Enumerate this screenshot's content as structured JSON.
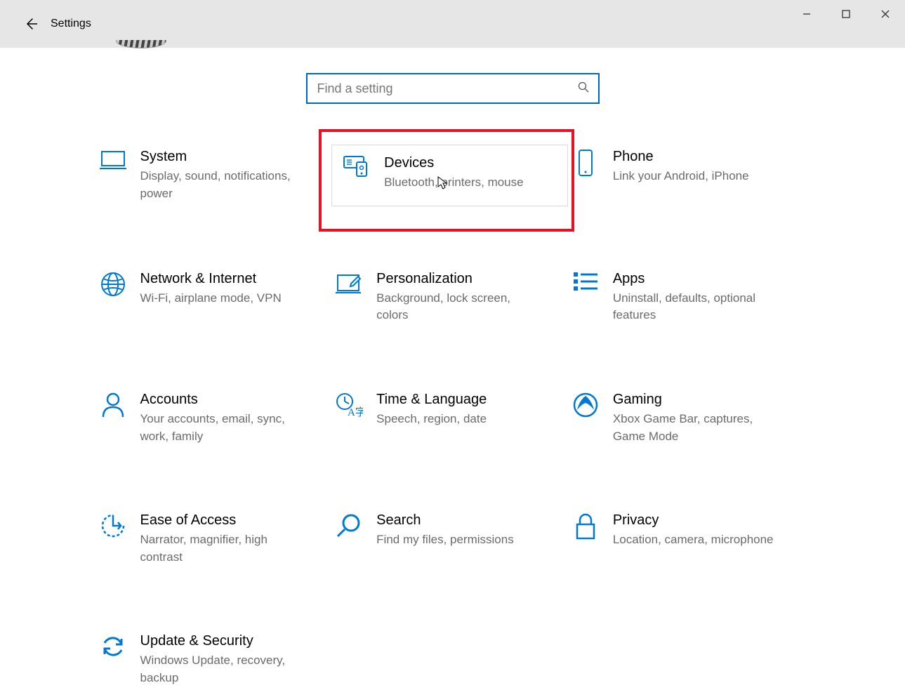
{
  "titlebar": {
    "title": "Settings"
  },
  "search": {
    "placeholder": "Find a setting"
  },
  "tiles": {
    "system": {
      "title": "System",
      "desc": "Display, sound, notifications, power"
    },
    "devices": {
      "title": "Devices",
      "desc": "Bluetooth, printers, mouse"
    },
    "phone": {
      "title": "Phone",
      "desc": "Link your Android, iPhone"
    },
    "network": {
      "title": "Network & Internet",
      "desc": "Wi-Fi, airplane mode, VPN"
    },
    "personalization": {
      "title": "Personalization",
      "desc": "Background, lock screen, colors"
    },
    "apps": {
      "title": "Apps",
      "desc": "Uninstall, defaults, optional features"
    },
    "accounts": {
      "title": "Accounts",
      "desc": "Your accounts, email, sync, work, family"
    },
    "time": {
      "title": "Time & Language",
      "desc": "Speech, region, date"
    },
    "gaming": {
      "title": "Gaming",
      "desc": "Xbox Game Bar, captures, Game Mode"
    },
    "ease": {
      "title": "Ease of Access",
      "desc": "Narrator, magnifier, high contrast"
    },
    "search_tile": {
      "title": "Search",
      "desc": "Find my files, permissions"
    },
    "privacy": {
      "title": "Privacy",
      "desc": "Location, camera, microphone"
    },
    "update": {
      "title": "Update & Security",
      "desc": "Windows Update, recovery, backup"
    }
  }
}
